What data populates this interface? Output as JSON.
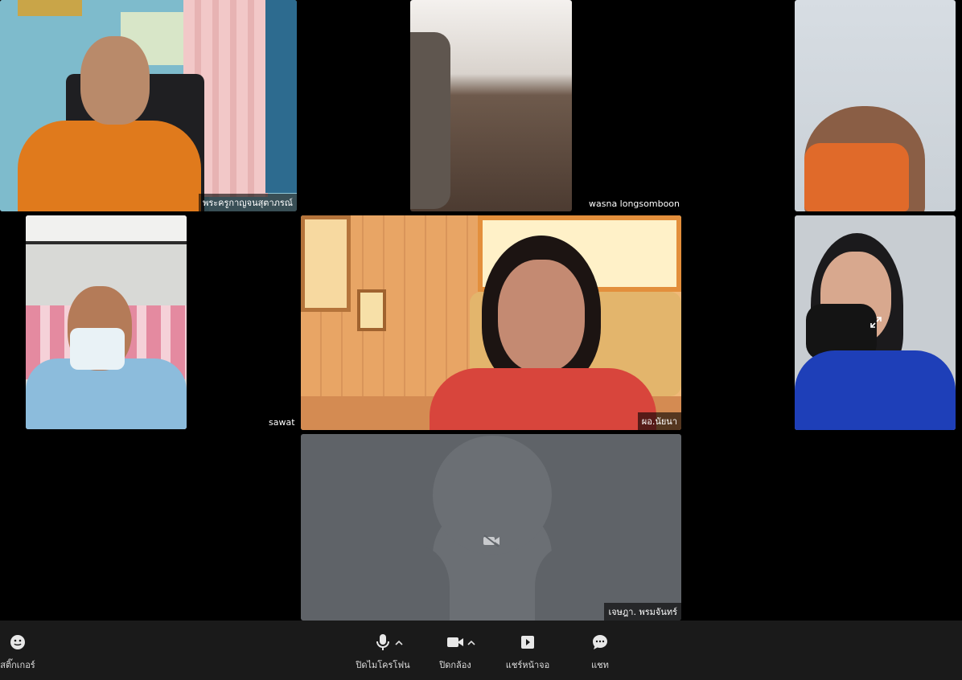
{
  "participants": [
    {
      "name": "พระครูกาญจนสุตาภรณ์"
    },
    {
      "name": "wasna longsomboon"
    },
    {
      "name": "sawat"
    },
    {
      "name": "ผอ.นัยนา"
    },
    {
      "name": "เจษฎา. พรมจันทร์"
    }
  ],
  "toolbar": {
    "sticker_label": "สติ๊กเกอร์",
    "mic_label": "ปิดไมโครโฟน",
    "camera_label": "ปิดกล้อง",
    "share_label": "แชร์หน้าจอ",
    "chat_label": "แชท"
  },
  "colors": {
    "stage_bg": "#000000",
    "toolbar_bg": "#1a1a1a",
    "camera_off_tile": "#5f6368"
  },
  "icons": [
    "smile-icon",
    "microphone-icon",
    "video-camera-icon",
    "share-screen-icon",
    "chat-bubble-icon",
    "expand-icon",
    "camera-off-icon",
    "caret-up-icon"
  ]
}
